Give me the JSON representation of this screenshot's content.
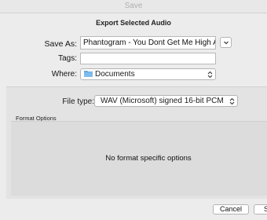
{
  "window": {
    "title": "Save"
  },
  "dialog": {
    "heading": "Export Selected Audio"
  },
  "save_as": {
    "label": "Save As:",
    "value": "Phantogram - You Dont Get Me High Anyway"
  },
  "tags": {
    "label": "Tags:",
    "value": ""
  },
  "where": {
    "label": "Where:",
    "value": "Documents",
    "icon": "folder-icon"
  },
  "file_type": {
    "label": "File type:",
    "value": "WAV (Microsoft) signed 16-bit PCM"
  },
  "format_options": {
    "label": "Format Options",
    "message": "No format specific options"
  },
  "buttons": {
    "cancel": "Cancel",
    "save": "Save"
  },
  "colors": {
    "folder": "#5aa7e6",
    "panel": "#e3e3e3",
    "window": "#ececec"
  }
}
